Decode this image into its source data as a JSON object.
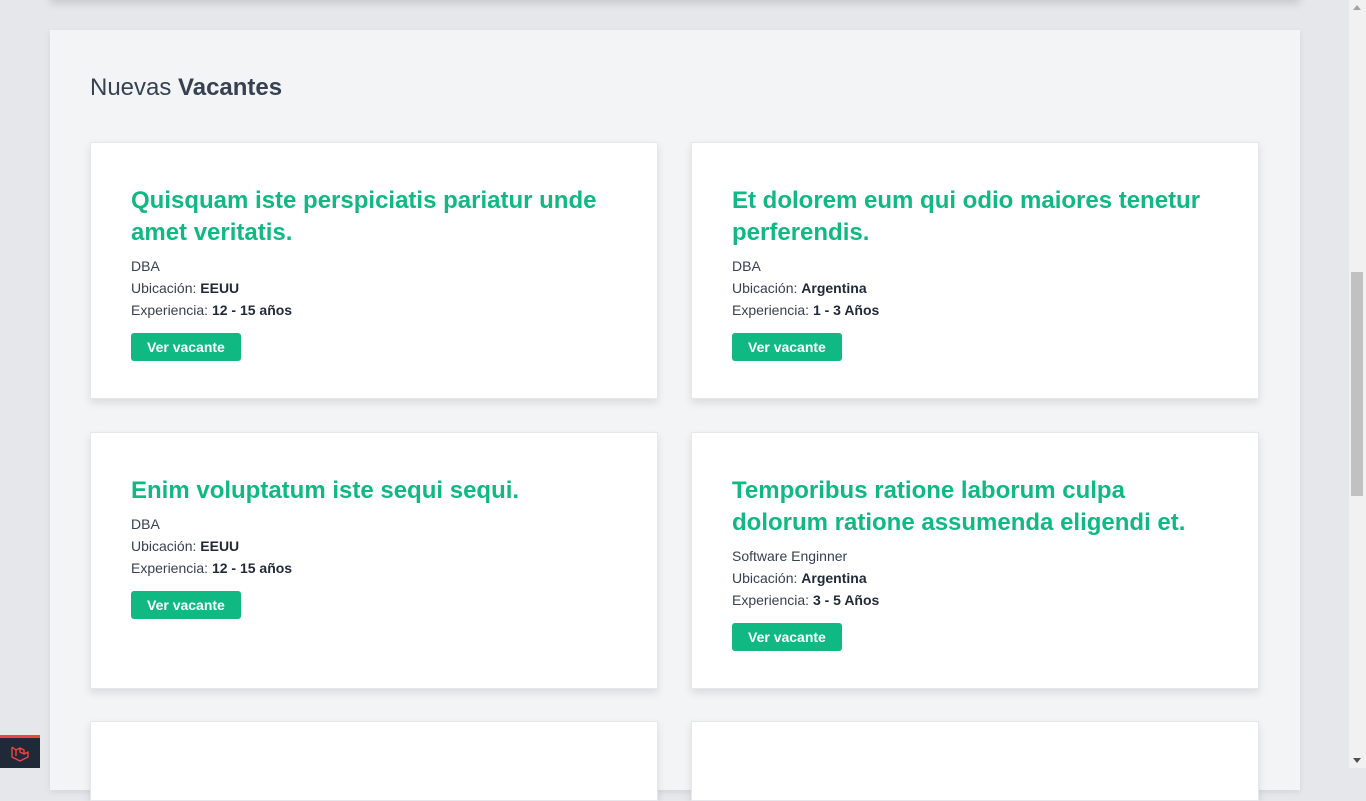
{
  "section": {
    "title_light": "Nuevas",
    "title_bold": "Vacantes"
  },
  "labels": {
    "location": "Ubicación:",
    "experience": "Experiencia:",
    "button": "Ver vacante"
  },
  "vacancies": [
    {
      "title": "Quisquam iste perspiciatis pariatur unde amet veritatis.",
      "category": "DBA",
      "location": "EEUU",
      "experience": "12 - 15 años"
    },
    {
      "title": "Et dolorem eum qui odio maiores tenetur perferendis.",
      "category": "DBA",
      "location": "Argentina",
      "experience": "1 - 3 Años"
    },
    {
      "title": "Enim voluptatum iste sequi sequi.",
      "category": "DBA",
      "location": "EEUU",
      "experience": "12 - 15 años"
    },
    {
      "title": "Temporibus ratione laborum culpa dolorum ratione assumenda eligendi et.",
      "category": "Software Enginner",
      "location": "Argentina",
      "experience": "3 - 5 Años"
    }
  ],
  "colors": {
    "accent": "#10b981",
    "background": "#e5e7eb",
    "panel": "#f3f4f6",
    "text": "#374151"
  },
  "icons": {
    "dev_badge": "laravel-logo-icon"
  }
}
